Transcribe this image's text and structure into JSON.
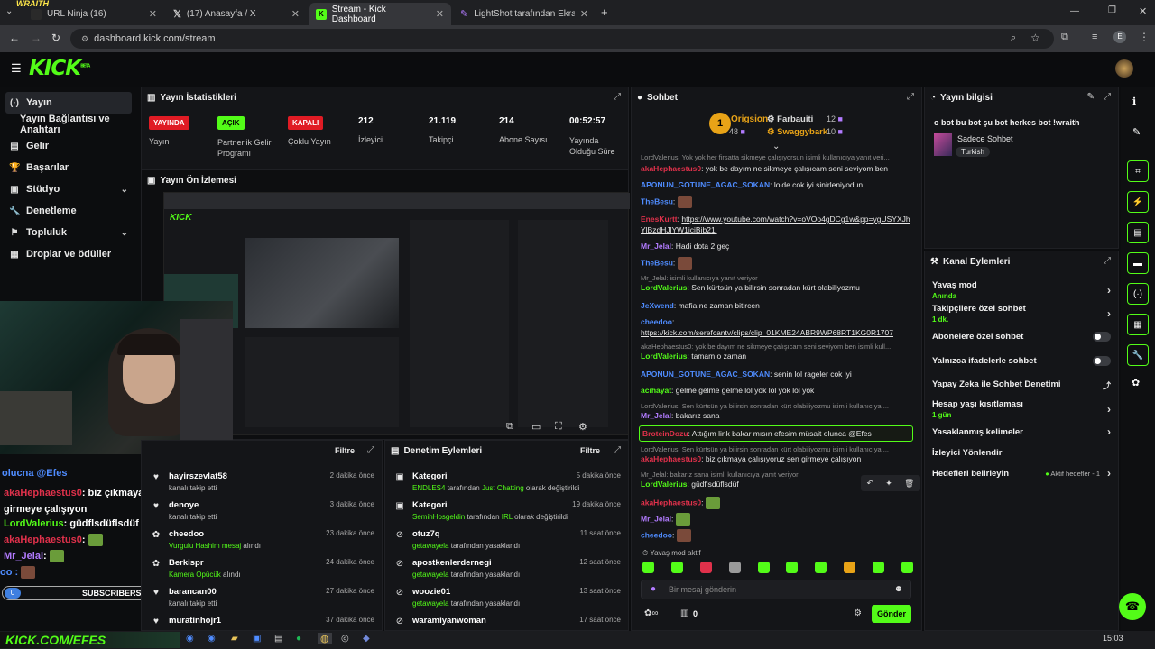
{
  "browser": {
    "tabs": [
      {
        "label": "URL Ninja (16)",
        "active": false
      },
      {
        "label": "(17) Anasayfa / X",
        "active": false
      },
      {
        "label": "Stream - Kick Dashboard",
        "active": true
      },
      {
        "label": "LightShot tarafından Ekran Gör...",
        "active": false
      }
    ],
    "url": "dashboard.kick.com/stream",
    "profile_initial": "E"
  },
  "overlay": {
    "wraith": "WRAITH",
    "subscribers_count": "0",
    "subscribers_label": "SUBSCRIBERS",
    "bottom_banner": "KICK.COM/EFES"
  },
  "header": {
    "logo": "KICK",
    "logo_beta": "BETA"
  },
  "sidebar": {
    "items": [
      {
        "label": "Yayın",
        "icon": "broadcast-icon"
      },
      {
        "label": "Yayın Bağlantısı ve Anahtarı",
        "icon": ""
      },
      {
        "label": "Gelir",
        "icon": "wallet-icon"
      },
      {
        "label": "Başarılar",
        "icon": "trophy-icon"
      },
      {
        "label": "Stüdyo",
        "icon": "studio-icon"
      },
      {
        "label": "Denetleme",
        "icon": "wrench-icon"
      },
      {
        "label": "Topluluk",
        "icon": "community-icon"
      },
      {
        "label": "Droplar ve ödüller",
        "icon": "drops-icon"
      }
    ]
  },
  "stats": {
    "title": "Yayın İstatistikleri",
    "items": [
      {
        "badge": "YAYINDA",
        "label": "Yayın",
        "color": "#e01b24"
      },
      {
        "badge": "AÇIK",
        "label": "Partnerlik Gelir Programı",
        "color": "#53fc18"
      },
      {
        "badge": "KAPALI",
        "label": "Çoklu Yayın",
        "color": "#e01b24"
      },
      {
        "value": "212",
        "label": "İzleyici"
      },
      {
        "value": "21.119",
        "label": "Takipçi"
      },
      {
        "value": "214",
        "label": "Abone Sayısı"
      },
      {
        "value": "00:52:57",
        "label": "Yayında Olduğu Süre"
      }
    ]
  },
  "preview": {
    "title": "Yayın Ön İzlemesi"
  },
  "activity": {
    "filter": "Filtre",
    "items": [
      {
        "name": "hayirszevlat58",
        "desc": "kanalı takip etti",
        "ago": "2 dakika önce"
      },
      {
        "name": "denoye",
        "desc": "kanalı takip etti",
        "ago": "3 dakika önce"
      },
      {
        "name": "cheedoo",
        "desc_green": "Vurgulu Hashim mesaj",
        "desc": "alındı",
        "ago": "23 dakika önce"
      },
      {
        "name": "Berkispr",
        "desc_green": "Kamera Öpücük",
        "desc": "alındı",
        "ago": "24 dakika önce"
      },
      {
        "name": "barancan00",
        "desc": "kanalı takip etti",
        "ago": "27 dakika önce"
      },
      {
        "name": "muratinhojr1",
        "desc": "",
        "ago": "37 dakika önce"
      }
    ]
  },
  "mod_actions": {
    "title": "Denetim Eylemleri",
    "filter": "Filtre",
    "items": [
      {
        "name": "Kategori",
        "actor": "ENDLES4",
        "mid": "tarafından",
        "target": "Just Chatting",
        "end": "olarak değiştirildi",
        "ago": "5 dakika önce"
      },
      {
        "name": "Kategori",
        "actor": "SemihHosgeldin",
        "mid": "tarafından",
        "target": "IRL",
        "end": "olarak değiştirildi",
        "ago": "19 dakika önce"
      },
      {
        "name": "otuz7q",
        "actor": "getawayela",
        "mid": "tarafından yasaklandı",
        "target": "",
        "end": "",
        "ago": "11 saat önce"
      },
      {
        "name": "apostkenlerdernegi",
        "actor": "getawayela",
        "mid": "tarafından yasaklandı",
        "target": "",
        "end": "",
        "ago": "12 saat önce"
      },
      {
        "name": "woozie01",
        "actor": "getawayela",
        "mid": "tarafından yasaklandı",
        "target": "",
        "end": "",
        "ago": "13 saat önce"
      },
      {
        "name": "waramiyanwoman",
        "actor": "",
        "mid": "",
        "target": "",
        "end": "",
        "ago": "17 saat önce"
      }
    ]
  },
  "chat": {
    "title": "Sohbet",
    "leaders": [
      {
        "rank": "1",
        "name": "Origsion",
        "count": "48"
      },
      {
        "name": "Farbauiti",
        "count": "12"
      },
      {
        "name": "Swaggybark",
        "count": "10"
      }
    ],
    "messages": [
      {
        "reply": "LordValerius: Yok yok her firsatta sikmeye çalışıyorsun isimli kullanıcıya yanıt veri..."
      },
      {
        "user": "akaHephaestus0",
        "color": "#e0314b",
        "text": ": yok be dayım ne sikmeye çalışıcam seni seviyom ben"
      },
      {
        "user": "APONUN_GOTUNE_AGAC_SOKAN",
        "color": "#4f8cff",
        "text": ": lolde cok iyi sinirleniyodun"
      },
      {
        "user": "TheBesu",
        "color": "#4f8cff",
        "text": ":",
        "emote": true
      },
      {
        "user": "EnesKurtt",
        "color": "#e0314b",
        "text": ": ",
        "link": "https://www.youtube.com/watch?v=oVOo4gDCg1w&pp=ygUSYXJhYlBzdHJlYW1iciBib21i"
      },
      {
        "user": "Mr_Jelal",
        "color": "#b27bff",
        "text": ": Hadi dota 2 geç"
      },
      {
        "user": "TheBesu",
        "color": "#4f8cff",
        "text": ":",
        "emote": true
      },
      {
        "reply": "Mr_Jelal: isimli kullanıcıya yanıt veriyor"
      },
      {
        "user": "LordValerius",
        "color": "#53fc18",
        "text": ": Sen kürtsün ya bilirsin sonradan kürt olabiliyozmu"
      },
      {
        "user": "JeXwend",
        "color": "#4f8cff",
        "text": ": mafia ne zaman bitircen"
      },
      {
        "user": "cheedoo",
        "color": "#4f8cff",
        "text": ":",
        "link": "https://kick.com/serefcantv/clips/clip_01KME24ABR9WP68RT1KG0R1707"
      },
      {
        "reply": "akaHephaestus0: yok be dayım ne sikmeye çalışıcam seni seviyom ben isimli kull..."
      },
      {
        "user": "LordValerius",
        "color": "#53fc18",
        "text": ": tamam o zaman"
      },
      {
        "user": "APONUN_GOTUNE_AGAC_SOKAN",
        "color": "#4f8cff",
        "text": ": senin lol rageler cok iyi"
      },
      {
        "user": "acihayat",
        "color": "#53fc18",
        "text": ": gelme gelme gelme lol yok lol yok lol yok"
      },
      {
        "reply": "LordValerius: Sen kürtsün ya bilirsin sonradan kürt olabiliyozmu isimli kullanıcıya ..."
      },
      {
        "user": "Mr_Jelal",
        "color": "#b27bff",
        "text": ": bakarız sana"
      },
      {
        "user": "BroteinDozu",
        "color": "#e0314b",
        "text": ": Attığım link bakar mısın efesim müsait olunca @Efes",
        "highlight": true
      },
      {
        "reply": "LordValerius: Sen kürtsün ya bilirsin sonradan kürt olabiliyozmu isimli kullanıcıya ..."
      },
      {
        "user": "akaHephaestus0",
        "color": "#e0314b",
        "text": ": biz çıkmaya çalışıyoruz sen girmeye çalışıyon"
      },
      {
        "reply": "Mr_Jelal: bakarız sana isimli kullanıcıya yanıt veriyor"
      },
      {
        "user": "LordValerius",
        "color": "#53fc18",
        "text": ": güdflsdüflsdüf"
      },
      {
        "user": "akaHephaestus0",
        "color": "#e0314b",
        "text": ":",
        "emote": true
      },
      {
        "user": "Mr_Jelal",
        "color": "#b27bff",
        "text": ":",
        "emote": true
      },
      {
        "user": "cheedoo",
        "color": "#4f8cff",
        "text": ":",
        "emote": true
      }
    ],
    "slow_mode": "Yavaş mod aktif",
    "input_placeholder": "Bir mesaj gönderin",
    "points": "0",
    "send": "Gönder"
  },
  "stream_info": {
    "title": "Yayın bilgisi",
    "stream_title": "o bot bu bot şu bot herkes bot !wraith",
    "category": "Sadece Sohbet",
    "tag": "Turkish"
  },
  "channel_actions": {
    "title": "Kanal Eylemleri",
    "items": [
      {
        "label": "Yavaş mod",
        "sub": "Anında",
        "kind": "arrow"
      },
      {
        "label": "Takipçilere özel sohbet",
        "sub": "1 dk.",
        "kind": "arrow"
      },
      {
        "label": "Abonelere özel sohbet",
        "sub": "",
        "kind": "toggle"
      },
      {
        "label": "Yalnızca ifadelerle sohbet",
        "sub": "",
        "kind": "toggle"
      },
      {
        "label": "Yapay Zeka ile Sohbet Denetimi",
        "sub": "",
        "kind": "ext"
      },
      {
        "label": "Hesap yaşı kısıtlaması",
        "sub": "1 gün",
        "kind": "arrow"
      },
      {
        "label": "Yasaklanmış kelimeler",
        "sub": "",
        "kind": "arrow"
      },
      {
        "label": "İzleyici Yönlendir",
        "sub": "",
        "kind": "none"
      },
      {
        "label": "Hedefleri belirleyin",
        "sub": "",
        "kind": "goal",
        "status": "Aktif hedefler - 1"
      }
    ]
  },
  "overlay_chat": [
    {
      "user": "",
      "text": "olucna @Efes",
      "color": "#4f8cff"
    },
    {
      "user": "akaHephaestus0",
      "text": ": biz çıkmaya çalışıyoruz sen girmeye çalışıyon",
      "color": "#e0314b"
    },
    {
      "user": "LordValerius",
      "text": ": güdflsdüflsdüf",
      "color": "#53fc18"
    },
    {
      "user": "akaHephaestus0",
      "text": ":",
      "color": "#e0314b"
    },
    {
      "user": "Mr_Jelal",
      "text": ":",
      "color": "#b27bff"
    },
    {
      "user": "",
      "text": "oo :",
      "color": "#4f8cff"
    }
  ],
  "taskbar": {
    "time": "15:03"
  }
}
